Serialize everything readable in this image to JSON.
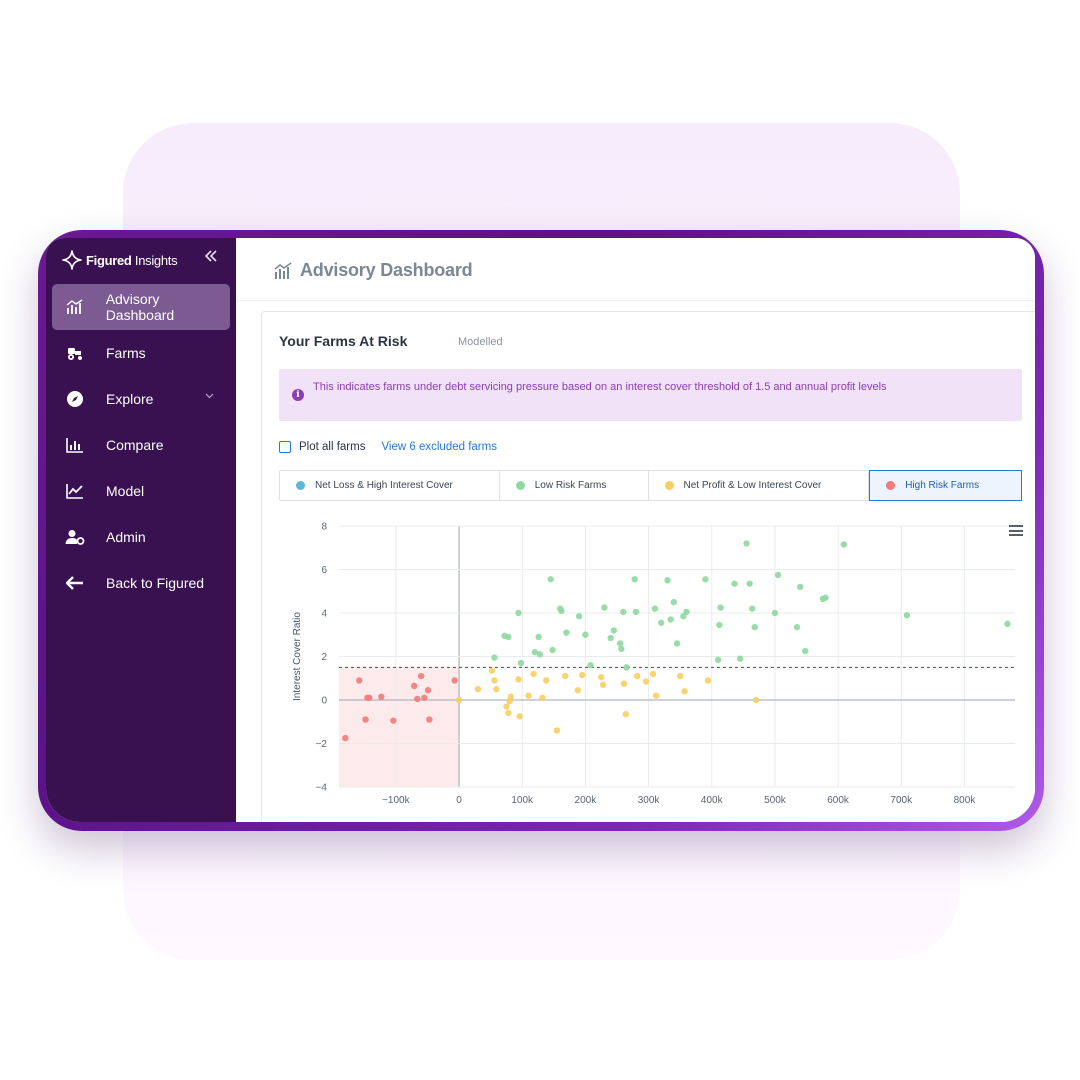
{
  "app": {
    "brand_bold": "Figured",
    "brand_light": " Insights"
  },
  "sidebar": {
    "items": [
      {
        "label": "Advisory Dashboard",
        "icon": "dashboard-icon",
        "active": true
      },
      {
        "label": "Farms",
        "icon": "tractor-icon"
      },
      {
        "label": "Explore",
        "icon": "compass-icon",
        "has_chevron": true
      },
      {
        "label": "Compare",
        "icon": "bar-chart-icon"
      },
      {
        "label": "Model",
        "icon": "line-chart-icon"
      },
      {
        "label": "Admin",
        "icon": "user-gear-icon"
      },
      {
        "label": "Back to Figured",
        "icon": "arrow-left-icon"
      }
    ]
  },
  "header": {
    "title": "Advisory Dashboard"
  },
  "card": {
    "title": "Your Farms At Risk",
    "subtitle": "Modelled",
    "banner": "This indicates farms under debt servicing pressure based on an interest cover threshold of 1.5 and annual profit levels",
    "plot_all_label": "Plot all farms",
    "excluded_link": "View 6 excluded farms"
  },
  "legend": [
    {
      "label": "Net Loss & High Interest Cover",
      "color": "#5bb8d6",
      "active": false
    },
    {
      "label": "Low Risk Farms",
      "color": "#8fd8a0",
      "active": false
    },
    {
      "label": "Net Profit & Low Interest Cover",
      "color": "#f6cf60",
      "active": false
    },
    {
      "label": "High Risk Farms",
      "color": "#f07b7b",
      "active": true
    }
  ],
  "colors": {
    "accent": "#2a78d6",
    "sidebar": "#3a1150",
    "frame": "#5c1288",
    "high_risk_zone": "#fdebec"
  },
  "chart_data": {
    "type": "scatter",
    "xlabel": "",
    "ylabel": "Interest Cover Ratio",
    "x_ticks": [
      "−100k",
      "0",
      "100k",
      "200k",
      "300k",
      "400k",
      "500k",
      "600k",
      "700k",
      "800k"
    ],
    "x_tick_values": [
      -100000,
      0,
      100000,
      200000,
      300000,
      400000,
      500000,
      600000,
      700000,
      800000
    ],
    "y_ticks": [
      "8",
      "6",
      "4",
      "2",
      "0",
      "−2",
      "−4"
    ],
    "y_tick_values": [
      8,
      6,
      4,
      2,
      0,
      -2,
      -4
    ],
    "xlim": [
      -190000,
      880000
    ],
    "ylim": [
      -4,
      8
    ],
    "threshold": 1.5,
    "high_risk_region": {
      "x": [
        -190000,
        0
      ],
      "y": [
        -4,
        1.5
      ]
    },
    "grid": true,
    "series": [
      {
        "name": "High Risk Farms",
        "color": "#f07b7b",
        "x": [
          -180000,
          -158000,
          -148000,
          -145000,
          -142000,
          -123000,
          -104000,
          -71000,
          -66000,
          -60000,
          -55000,
          -49000,
          -47000,
          -7000
        ],
        "y": [
          -1.75,
          0.9,
          -0.9,
          0.1,
          0.1,
          0.15,
          -0.95,
          0.65,
          0.05,
          1.1,
          0.1,
          0.45,
          -0.9,
          0.9
        ]
      },
      {
        "name": "Net Profit & Low Interest Cover",
        "color": "#f6cf60",
        "x": [
          0,
          30000,
          52000,
          56000,
          59000,
          75000,
          78000,
          80000,
          82000,
          94000,
          96000,
          110000,
          118000,
          132000,
          138000,
          155000,
          168000,
          188000,
          195000,
          225000,
          228000,
          261000,
          264000,
          282000,
          296000,
          307000,
          312000,
          350000,
          357000,
          394000,
          470000
        ],
        "y": [
          0,
          0.5,
          1.35,
          0.9,
          0.5,
          -0.3,
          -0.6,
          -0.05,
          0.15,
          0.95,
          -0.75,
          0.2,
          1.2,
          0.1,
          0.9,
          -1.4,
          1.1,
          0.45,
          1.15,
          1.05,
          0.7,
          0.75,
          -0.65,
          1.1,
          0.85,
          1.2,
          0.2,
          1.1,
          0.4,
          0.9,
          0
        ]
      },
      {
        "name": "Low Risk Farms",
        "color": "#8fd8a0",
        "x": [
          56000,
          72000,
          78000,
          94000,
          98000,
          120000,
          126000,
          128000,
          145000,
          148000,
          160000,
          162000,
          170000,
          190000,
          200000,
          208000,
          230000,
          240000,
          245000,
          255000,
          257000,
          260000,
          265000,
          278000,
          280000,
          310000,
          320000,
          330000,
          335000,
          340000,
          345000,
          355000,
          360000,
          390000,
          410000,
          412000,
          414000,
          436000,
          445000,
          455000,
          460000,
          464000,
          468000,
          500000,
          505000,
          535000,
          540000,
          548000,
          576000,
          580000,
          609000,
          709000,
          868000
        ],
        "y": [
          1.95,
          2.95,
          2.9,
          4.0,
          1.7,
          2.2,
          2.9,
          2.1,
          5.55,
          2.3,
          4.2,
          4.1,
          3.1,
          3.85,
          3.0,
          1.6,
          4.25,
          2.85,
          3.2,
          2.6,
          2.35,
          4.05,
          1.5,
          5.55,
          4.05,
          4.2,
          3.55,
          5.5,
          3.7,
          4.5,
          2.6,
          3.85,
          4.05,
          5.55,
          1.85,
          3.45,
          4.25,
          5.35,
          1.9,
          7.2,
          5.35,
          4.2,
          3.35,
          4.0,
          5.75,
          3.35,
          5.2,
          2.25,
          4.65,
          4.7,
          7.15,
          3.9,
          3.5
        ]
      }
    ]
  }
}
